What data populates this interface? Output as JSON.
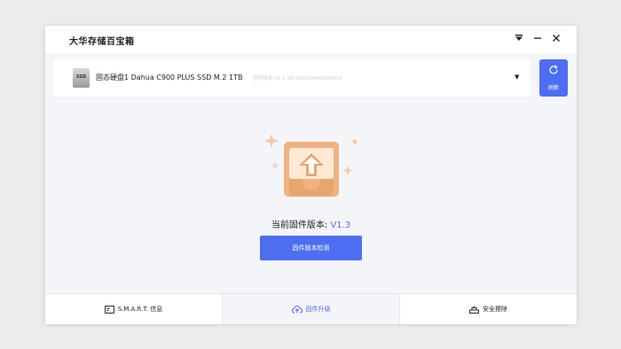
{
  "app": {
    "title": "大华存储百宝箱"
  },
  "titlebar": {
    "menu_icon": "dropdown-triangle-icon",
    "minimize_icon": "minimize-icon",
    "close_icon": "close-icon"
  },
  "disk": {
    "icon_label": "SSD",
    "name": "固态硬盘1  Dahua C900 PLUS SSD M.2 1TB",
    "meta": "固件版本:V1.3   SN:2012264A0000814"
  },
  "refresh": {
    "label": "刷新"
  },
  "firmware": {
    "version_label": "当前固件版本: ",
    "version_value": "V1.3",
    "check_button": "固件版本检测"
  },
  "nav": {
    "tabs": [
      {
        "label": "S.M.A.R.T. 信息",
        "icon": "info-card-icon",
        "active": false
      },
      {
        "label": "固件升级",
        "icon": "cloud-upload-icon",
        "active": true
      },
      {
        "label": "安全擦除",
        "icon": "eraser-icon",
        "active": false
      }
    ]
  },
  "colors": {
    "accent": "#4e6ef2",
    "illustration": "#f0b27f",
    "sparkle": "#f6c9a3"
  }
}
